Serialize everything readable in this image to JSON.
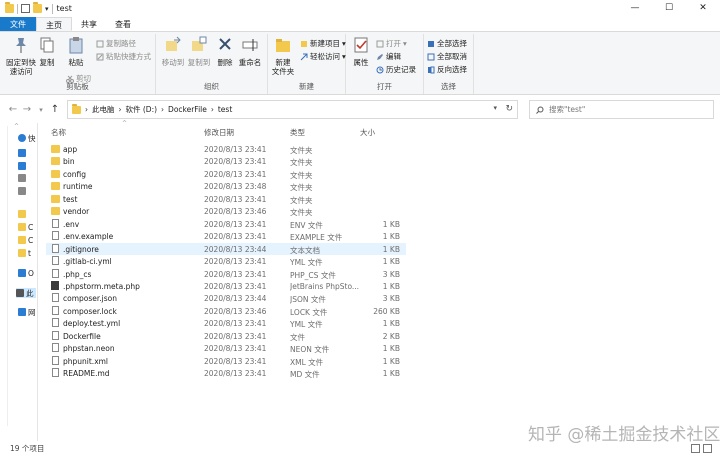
{
  "window": {
    "title": "test",
    "controls": {
      "minimize": "—",
      "maximize": "☐",
      "close": "✕"
    }
  },
  "ribbon_tabs": [
    "文件",
    "主页",
    "共享",
    "查看"
  ],
  "ribbon": {
    "clipboard": {
      "label": "剪贴板",
      "pin": "固定到快\n速访问",
      "copy": "复制",
      "paste": "粘贴",
      "copy_path": "复制路径",
      "paste_shortcut": "粘贴快捷方式",
      "cut": "剪切"
    },
    "organize": {
      "label": "组织",
      "move_to": "移动到",
      "copy_to": "复制到",
      "delete": "删除",
      "rename": "重命名"
    },
    "new": {
      "label": "新建",
      "new_item": "新建项目",
      "easy_access": "轻松访问",
      "new_folder": "新建\n文件夹"
    },
    "open": {
      "label": "打开",
      "properties": "属性",
      "open": "打开",
      "edit": "编辑",
      "history": "历史记录"
    },
    "select": {
      "label": "选择",
      "select_all": "全部选择",
      "select_none": "全部取消",
      "invert": "反向选择"
    }
  },
  "address": {
    "crumbs": [
      "此电脑",
      "软件 (D:)",
      "DockerFile",
      "test"
    ],
    "search_placeholder": "搜索\"test\""
  },
  "navpane": {
    "items": [
      {
        "label": "快",
        "icon": "star-icon",
        "color": "#2b7cd3"
      },
      {
        "label": "",
        "icon": "desktop-icon",
        "color": "#2b7cd3"
      },
      {
        "label": "",
        "icon": "download-icon",
        "color": "#2b7cd3"
      },
      {
        "label": "",
        "icon": "document-icon",
        "color": "#888888"
      },
      {
        "label": "",
        "icon": "picture-icon",
        "color": "#888888"
      },
      {
        "label": "",
        "icon": "folder-icon",
        "color": "#f2c94c"
      },
      {
        "label": "C",
        "icon": "folder-icon",
        "color": "#f2c94c"
      },
      {
        "label": "C",
        "icon": "folder-icon",
        "color": "#f2c94c"
      },
      {
        "label": "t",
        "icon": "folder-icon",
        "color": "#f2c94c"
      },
      {
        "label": "O",
        "icon": "onedrive-icon",
        "color": "#2b7cd3"
      },
      {
        "label": "此",
        "icon": "pc-icon",
        "color": "#555555"
      },
      {
        "label": "网",
        "icon": "network-icon",
        "color": "#2b7cd3"
      }
    ]
  },
  "columns": {
    "name": "名称",
    "date": "修改日期",
    "type": "类型",
    "size": "大小"
  },
  "files": [
    {
      "name": "app",
      "date": "2020/8/13 23:41",
      "type": "文件夹",
      "size": "",
      "kind": "folder"
    },
    {
      "name": "bin",
      "date": "2020/8/13 23:41",
      "type": "文件夹",
      "size": "",
      "kind": "folder"
    },
    {
      "name": "config",
      "date": "2020/8/13 23:41",
      "type": "文件夹",
      "size": "",
      "kind": "folder"
    },
    {
      "name": "runtime",
      "date": "2020/8/13 23:48",
      "type": "文件夹",
      "size": "",
      "kind": "folder"
    },
    {
      "name": "test",
      "date": "2020/8/13 23:41",
      "type": "文件夹",
      "size": "",
      "kind": "folder"
    },
    {
      "name": "vendor",
      "date": "2020/8/13 23:46",
      "type": "文件夹",
      "size": "",
      "kind": "folder"
    },
    {
      "name": ".env",
      "date": "2020/8/13 23:41",
      "type": "ENV 文件",
      "size": "1 KB",
      "kind": "file"
    },
    {
      "name": ".env.example",
      "date": "2020/8/13 23:41",
      "type": "EXAMPLE 文件",
      "size": "1 KB",
      "kind": "file"
    },
    {
      "name": ".gitignore",
      "date": "2020/8/13 23:44",
      "type": "文本文档",
      "size": "1 KB",
      "kind": "file",
      "highlight": true
    },
    {
      "name": ".gitlab-ci.yml",
      "date": "2020/8/13 23:41",
      "type": "YML 文件",
      "size": "1 KB",
      "kind": "file"
    },
    {
      "name": ".php_cs",
      "date": "2020/8/13 23:41",
      "type": "PHP_CS 文件",
      "size": "3 KB",
      "kind": "file"
    },
    {
      "name": ".phpstorm.meta.php",
      "date": "2020/8/13 23:41",
      "type": "JetBrains PhpSto...",
      "size": "1 KB",
      "kind": "php"
    },
    {
      "name": "composer.json",
      "date": "2020/8/13 23:44",
      "type": "JSON 文件",
      "size": "3 KB",
      "kind": "file"
    },
    {
      "name": "composer.lock",
      "date": "2020/8/13 23:46",
      "type": "LOCK 文件",
      "size": "260 KB",
      "kind": "file"
    },
    {
      "name": "deploy.test.yml",
      "date": "2020/8/13 23:41",
      "type": "YML 文件",
      "size": "1 KB",
      "kind": "file"
    },
    {
      "name": "Dockerfile",
      "date": "2020/8/13 23:41",
      "type": "文件",
      "size": "2 KB",
      "kind": "file"
    },
    {
      "name": "phpstan.neon",
      "date": "2020/8/13 23:41",
      "type": "NEON 文件",
      "size": "1 KB",
      "kind": "file"
    },
    {
      "name": "phpunit.xml",
      "date": "2020/8/13 23:41",
      "type": "XML 文件",
      "size": "1 KB",
      "kind": "file"
    },
    {
      "name": "README.md",
      "date": "2020/8/13 23:41",
      "type": "MD 文件",
      "size": "1 KB",
      "kind": "file"
    }
  ],
  "status": {
    "count": "19 个项目"
  },
  "watermark": "知乎 @稀土掘金技术社区",
  "colors": {
    "accent": "#1979ca",
    "folder": "#f2c94c",
    "highlight_row": "#e5f3ff"
  }
}
